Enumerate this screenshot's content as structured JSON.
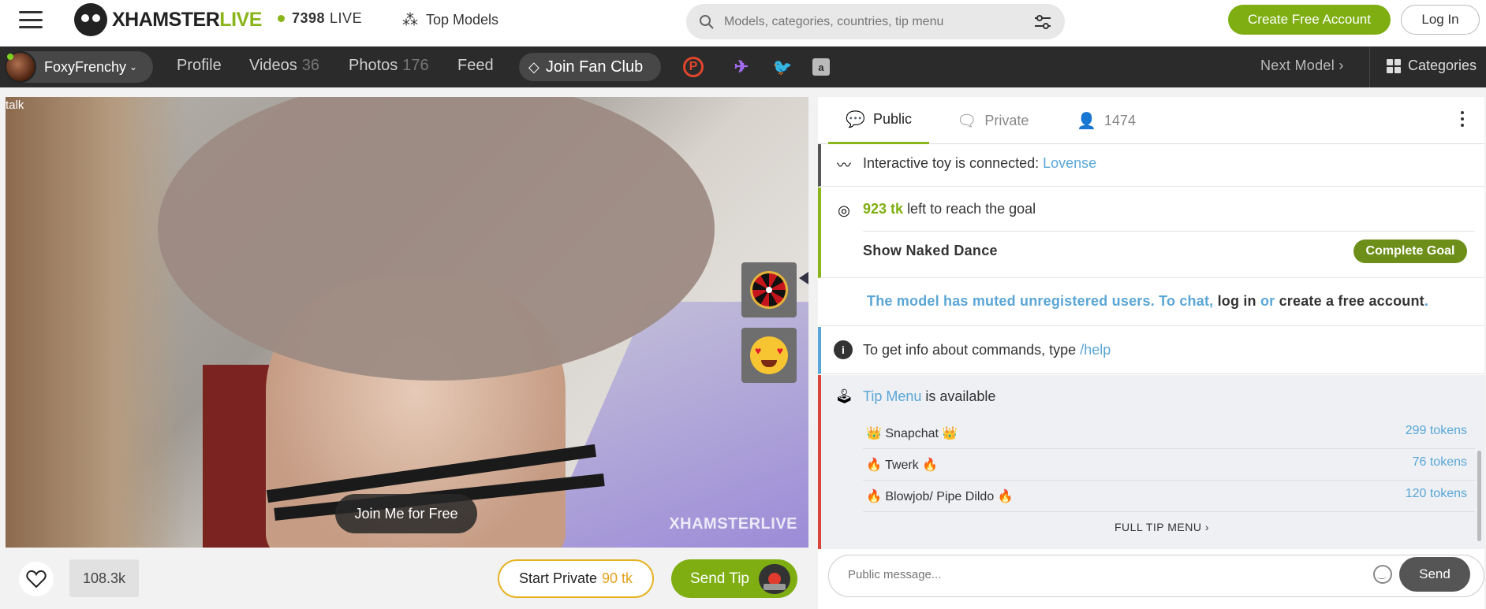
{
  "header": {
    "logo_part1": "XHAMSTER",
    "logo_part2": "LIVE",
    "live_count": "7398",
    "live_label": "LIVE",
    "top_models": "Top Models",
    "search_placeholder": "Models, categories, countries, tip menu",
    "create_account": "Create Free Account",
    "login": "Log In"
  },
  "model_bar": {
    "model_name": "FoxyFrenchy",
    "profile": "Profile",
    "videos": "Videos",
    "videos_count": "36",
    "photos": "Photos",
    "photos_count": "176",
    "feed": "Feed",
    "fan_club": "Join Fan Club",
    "next_model": "Next Model",
    "categories": "Categories"
  },
  "video": {
    "overlay_text": "talk",
    "watermark": "XHAMSTERLIVE",
    "join_free": "Join Me for Free"
  },
  "controls": {
    "likes": "108.3k",
    "start_private": "Start Private",
    "private_price": "90 tk",
    "send_tip": "Send Tip"
  },
  "chat": {
    "tab_public": "Public",
    "tab_private": "Private",
    "viewer_count": "1474",
    "toy_text": "Interactive toy is connected:",
    "toy_name": "Lovense",
    "goal_amount": "923 tk",
    "goal_text": "left to reach the goal",
    "goal_name": "Show Naked Dance",
    "complete_goal": "Complete Goal",
    "muted_1": "The model has muted unregistered users. To chat,",
    "muted_login": "log in",
    "muted_or": "or",
    "muted_create": "create a free account",
    "muted_end": ".",
    "help_text": "To get info about commands, type",
    "help_cmd": "/help",
    "tip_menu_link": "Tip Menu",
    "tip_menu_text": "is available",
    "tip_items": [
      {
        "name": "👑 Snapchat 👑",
        "price": "299 tokens"
      },
      {
        "name": "🔥 Twerk 🔥",
        "price": "76 tokens"
      },
      {
        "name": "🔥 Blowjob/ Pipe Dildo 🔥",
        "price": "120 tokens"
      }
    ],
    "full_tip_menu": "FULL TIP MENU",
    "message_placeholder": "Public message...",
    "send": "Send"
  },
  "colors": {
    "accent_green": "#7eae12",
    "link_blue": "#5aa6d6",
    "toy_bar": "#555555",
    "goal_bar": "#8ab51b",
    "help_bar": "#5aa6d6",
    "tip_bar": "#d9453b"
  }
}
